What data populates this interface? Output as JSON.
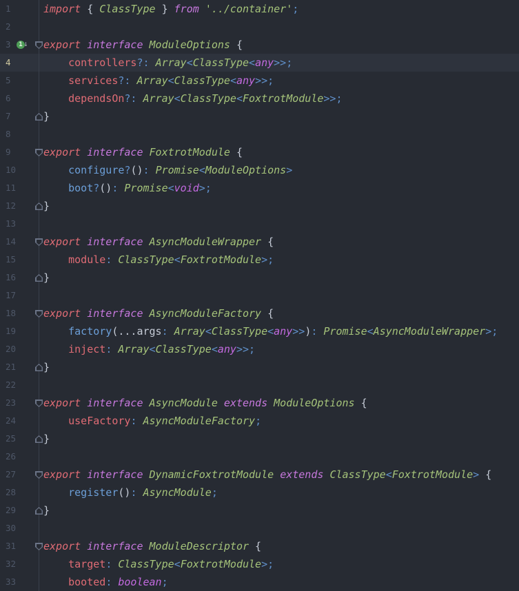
{
  "editor": {
    "palette": {
      "bg": "#272b33",
      "currentLineBg": "#2e333d",
      "separator": "#3a404b",
      "lineNum": "#4e5768",
      "lineNumCurrent": "#d3cba2",
      "foldIcon": "#6b7487",
      "runGreen": "#4f9e58",
      "kw1": "#e06c75",
      "kw2": "#c678dd",
      "typ": "#a5c37a",
      "prim": "#c36ae0",
      "str": "#a5c37a",
      "fld": "#e06c75",
      "mth": "#6c9fd8",
      "op": "#6090ca",
      "pun": "#c6ccd7"
    },
    "gutter_icon": {
      "name": "implementation-marker-icon",
      "badge": "1",
      "arrow": "↓"
    },
    "lines": [
      {
        "n": 1,
        "tokens": [
          [
            "kw1",
            "import"
          ],
          [
            "pun",
            " { "
          ],
          [
            "typ",
            "ClassType"
          ],
          [
            "pun",
            " } "
          ],
          [
            "kw2",
            "from"
          ],
          [
            "pun",
            " "
          ],
          [
            "str",
            "'../container'"
          ],
          [
            "op",
            ";"
          ]
        ]
      },
      {
        "n": 2,
        "tokens": []
      },
      {
        "n": 3,
        "fold": "start",
        "icon": true,
        "tokens": [
          [
            "kw1",
            "export"
          ],
          [
            "pun",
            " "
          ],
          [
            "kw2",
            "interface"
          ],
          [
            "pun",
            " "
          ],
          [
            "typ",
            "ModuleOptions"
          ],
          [
            "pun",
            " {"
          ]
        ]
      },
      {
        "n": 4,
        "current": true,
        "tokens": [
          [
            "pun",
            "    "
          ],
          [
            "fld",
            "controllers"
          ],
          [
            "op",
            "?:"
          ],
          [
            "pun",
            " "
          ],
          [
            "typ",
            "Array"
          ],
          [
            "op",
            "<"
          ],
          [
            "typ",
            "ClassType"
          ],
          [
            "op",
            "<"
          ],
          [
            "prim",
            "any"
          ],
          [
            "op",
            ">>;"
          ]
        ]
      },
      {
        "n": 5,
        "tokens": [
          [
            "pun",
            "    "
          ],
          [
            "fld",
            "services"
          ],
          [
            "op",
            "?:"
          ],
          [
            "pun",
            " "
          ],
          [
            "typ",
            "Array"
          ],
          [
            "op",
            "<"
          ],
          [
            "typ",
            "ClassType"
          ],
          [
            "op",
            "<"
          ],
          [
            "prim",
            "any"
          ],
          [
            "op",
            ">>;"
          ]
        ]
      },
      {
        "n": 6,
        "tokens": [
          [
            "pun",
            "    "
          ],
          [
            "fld",
            "dependsOn"
          ],
          [
            "op",
            "?:"
          ],
          [
            "pun",
            " "
          ],
          [
            "typ",
            "Array"
          ],
          [
            "op",
            "<"
          ],
          [
            "typ",
            "ClassType"
          ],
          [
            "op",
            "<"
          ],
          [
            "typ",
            "FoxtrotModule"
          ],
          [
            "op",
            ">>;"
          ]
        ]
      },
      {
        "n": 7,
        "fold": "end",
        "tokens": [
          [
            "pun",
            "}"
          ]
        ]
      },
      {
        "n": 8,
        "tokens": []
      },
      {
        "n": 9,
        "fold": "start",
        "tokens": [
          [
            "kw1",
            "export"
          ],
          [
            "pun",
            " "
          ],
          [
            "kw2",
            "interface"
          ],
          [
            "pun",
            " "
          ],
          [
            "typ",
            "FoxtrotModule"
          ],
          [
            "pun",
            " {"
          ]
        ]
      },
      {
        "n": 10,
        "tokens": [
          [
            "pun",
            "    "
          ],
          [
            "mth",
            "configure"
          ],
          [
            "op",
            "?"
          ],
          [
            "pun",
            "()"
          ],
          [
            "op",
            ":"
          ],
          [
            "pun",
            " "
          ],
          [
            "typ",
            "Promise"
          ],
          [
            "op",
            "<"
          ],
          [
            "typ",
            "ModuleOptions"
          ],
          [
            "op",
            ">"
          ]
        ]
      },
      {
        "n": 11,
        "tokens": [
          [
            "pun",
            "    "
          ],
          [
            "mth",
            "boot"
          ],
          [
            "op",
            "?"
          ],
          [
            "pun",
            "()"
          ],
          [
            "op",
            ":"
          ],
          [
            "pun",
            " "
          ],
          [
            "typ",
            "Promise"
          ],
          [
            "op",
            "<"
          ],
          [
            "prim",
            "void"
          ],
          [
            "op",
            ">;"
          ]
        ]
      },
      {
        "n": 12,
        "fold": "end",
        "tokens": [
          [
            "pun",
            "}"
          ]
        ]
      },
      {
        "n": 13,
        "tokens": []
      },
      {
        "n": 14,
        "fold": "start",
        "tokens": [
          [
            "kw1",
            "export"
          ],
          [
            "pun",
            " "
          ],
          [
            "kw2",
            "interface"
          ],
          [
            "pun",
            " "
          ],
          [
            "typ",
            "AsyncModuleWrapper"
          ],
          [
            "pun",
            " {"
          ]
        ]
      },
      {
        "n": 15,
        "tokens": [
          [
            "pun",
            "    "
          ],
          [
            "fld",
            "module"
          ],
          [
            "op",
            ":"
          ],
          [
            "pun",
            " "
          ],
          [
            "typ",
            "ClassType"
          ],
          [
            "op",
            "<"
          ],
          [
            "typ",
            "FoxtrotModule"
          ],
          [
            "op",
            ">;"
          ]
        ]
      },
      {
        "n": 16,
        "fold": "end",
        "tokens": [
          [
            "pun",
            "}"
          ]
        ]
      },
      {
        "n": 17,
        "tokens": []
      },
      {
        "n": 18,
        "fold": "start",
        "tokens": [
          [
            "kw1",
            "export"
          ],
          [
            "pun",
            " "
          ],
          [
            "kw2",
            "interface"
          ],
          [
            "pun",
            " "
          ],
          [
            "typ",
            "AsyncModuleFactory"
          ],
          [
            "pun",
            " {"
          ]
        ]
      },
      {
        "n": 19,
        "tokens": [
          [
            "pun",
            "    "
          ],
          [
            "mth",
            "factory"
          ],
          [
            "pun",
            "(...args"
          ],
          [
            "op",
            ":"
          ],
          [
            "pun",
            " "
          ],
          [
            "typ",
            "Array"
          ],
          [
            "op",
            "<"
          ],
          [
            "typ",
            "ClassType"
          ],
          [
            "op",
            "<"
          ],
          [
            "prim",
            "any"
          ],
          [
            "op",
            ">>"
          ],
          [
            "pun",
            ")"
          ],
          [
            "op",
            ":"
          ],
          [
            "pun",
            " "
          ],
          [
            "typ",
            "Promise"
          ],
          [
            "op",
            "<"
          ],
          [
            "typ",
            "AsyncModuleWrapper"
          ],
          [
            "op",
            ">;"
          ]
        ]
      },
      {
        "n": 20,
        "tokens": [
          [
            "pun",
            "    "
          ],
          [
            "fld",
            "inject"
          ],
          [
            "op",
            ":"
          ],
          [
            "pun",
            " "
          ],
          [
            "typ",
            "Array"
          ],
          [
            "op",
            "<"
          ],
          [
            "typ",
            "ClassType"
          ],
          [
            "op",
            "<"
          ],
          [
            "prim",
            "any"
          ],
          [
            "op",
            ">>;"
          ]
        ]
      },
      {
        "n": 21,
        "fold": "end",
        "tokens": [
          [
            "pun",
            "}"
          ]
        ]
      },
      {
        "n": 22,
        "tokens": []
      },
      {
        "n": 23,
        "fold": "start",
        "tokens": [
          [
            "kw1",
            "export"
          ],
          [
            "pun",
            " "
          ],
          [
            "kw2",
            "interface"
          ],
          [
            "pun",
            " "
          ],
          [
            "typ",
            "AsyncModule"
          ],
          [
            "pun",
            " "
          ],
          [
            "kw2",
            "extends"
          ],
          [
            "pun",
            " "
          ],
          [
            "typ",
            "ModuleOptions"
          ],
          [
            "pun",
            " {"
          ]
        ]
      },
      {
        "n": 24,
        "tokens": [
          [
            "pun",
            "    "
          ],
          [
            "fld",
            "useFactory"
          ],
          [
            "op",
            ":"
          ],
          [
            "pun",
            " "
          ],
          [
            "typ",
            "AsyncModuleFactory"
          ],
          [
            "op",
            ";"
          ]
        ]
      },
      {
        "n": 25,
        "fold": "end",
        "tokens": [
          [
            "pun",
            "}"
          ]
        ]
      },
      {
        "n": 26,
        "tokens": []
      },
      {
        "n": 27,
        "fold": "start",
        "tokens": [
          [
            "kw1",
            "export"
          ],
          [
            "pun",
            " "
          ],
          [
            "kw2",
            "interface"
          ],
          [
            "pun",
            " "
          ],
          [
            "typ",
            "DynamicFoxtrotModule"
          ],
          [
            "pun",
            " "
          ],
          [
            "kw2",
            "extends"
          ],
          [
            "pun",
            " "
          ],
          [
            "typ",
            "ClassType"
          ],
          [
            "op",
            "<"
          ],
          [
            "typ",
            "FoxtrotModule"
          ],
          [
            "op",
            ">"
          ],
          [
            "pun",
            " {"
          ]
        ]
      },
      {
        "n": 28,
        "tokens": [
          [
            "pun",
            "    "
          ],
          [
            "mth",
            "register"
          ],
          [
            "pun",
            "()"
          ],
          [
            "op",
            ":"
          ],
          [
            "pun",
            " "
          ],
          [
            "typ",
            "AsyncModule"
          ],
          [
            "op",
            ";"
          ]
        ]
      },
      {
        "n": 29,
        "fold": "end",
        "tokens": [
          [
            "pun",
            "}"
          ]
        ]
      },
      {
        "n": 30,
        "tokens": []
      },
      {
        "n": 31,
        "fold": "start",
        "tokens": [
          [
            "kw1",
            "export"
          ],
          [
            "pun",
            " "
          ],
          [
            "kw2",
            "interface"
          ],
          [
            "pun",
            " "
          ],
          [
            "typ",
            "ModuleDescriptor"
          ],
          [
            "pun",
            " {"
          ]
        ]
      },
      {
        "n": 32,
        "tokens": [
          [
            "pun",
            "    "
          ],
          [
            "fld",
            "target"
          ],
          [
            "op",
            ":"
          ],
          [
            "pun",
            " "
          ],
          [
            "typ",
            "ClassType"
          ],
          [
            "op",
            "<"
          ],
          [
            "typ",
            "FoxtrotModule"
          ],
          [
            "op",
            ">;"
          ]
        ]
      },
      {
        "n": 33,
        "tokens": [
          [
            "pun",
            "    "
          ],
          [
            "fld",
            "booted"
          ],
          [
            "op",
            ":"
          ],
          [
            "pun",
            " "
          ],
          [
            "prim",
            "boolean"
          ],
          [
            "op",
            ";"
          ]
        ]
      }
    ]
  }
}
